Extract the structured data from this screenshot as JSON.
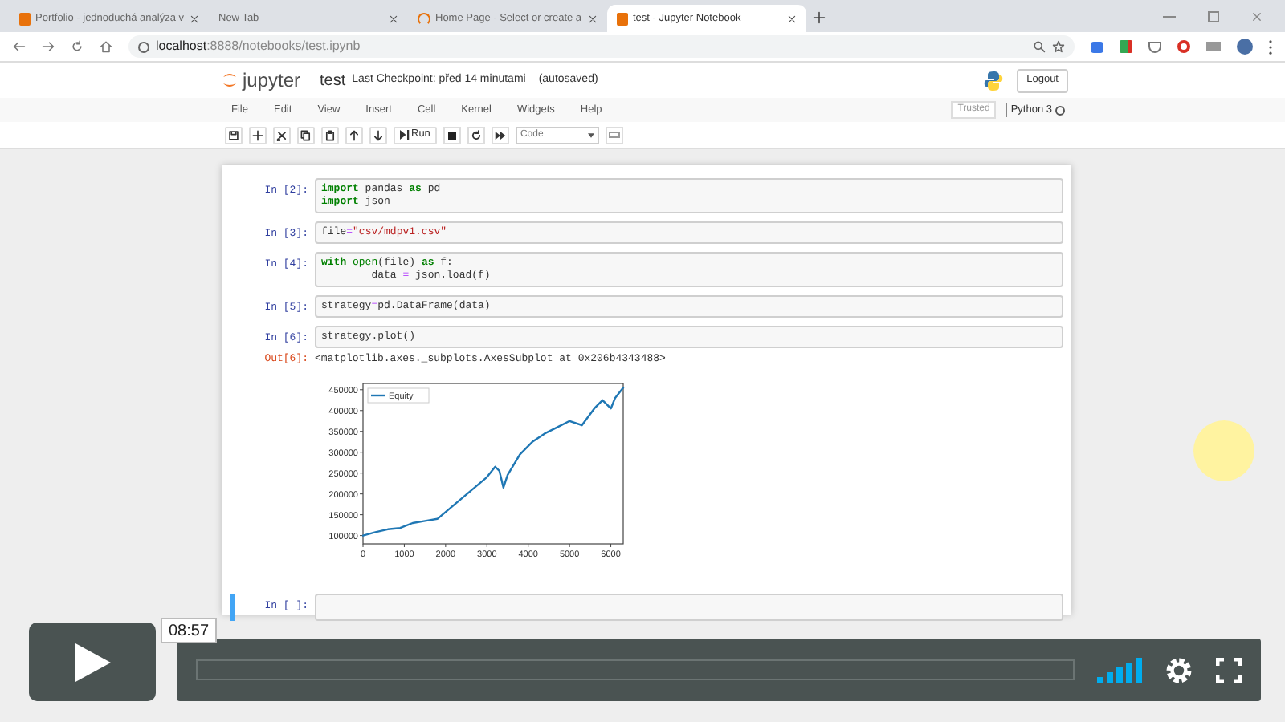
{
  "browser": {
    "tabs": [
      {
        "title": "Portfolio - jednoduchá analýza v",
        "selected": false,
        "kind": "page"
      },
      {
        "title": "New Tab",
        "selected": false,
        "kind": "plain"
      },
      {
        "title": "Home Page - Select or create a",
        "selected": false,
        "kind": "loading"
      },
      {
        "title": "test - Jupyter Notebook",
        "selected": true,
        "kind": "page"
      }
    ],
    "address": {
      "host": "localhost",
      "path": ":8888/notebooks/test.ipynb"
    }
  },
  "jupyter": {
    "logo": "jupyter",
    "notebook_name": "test",
    "checkpoint": "Last Checkpoint: před 14 minutami",
    "autosaved": "(autosaved)",
    "logout": "Logout",
    "menu": [
      "File",
      "Edit",
      "View",
      "Insert",
      "Cell",
      "Kernel",
      "Widgets",
      "Help"
    ],
    "run_label": "Run",
    "cell_type": "Code",
    "trusted": "Trusted",
    "kernel": "Python 3"
  },
  "cells": [
    {
      "prompt": "In [2]:",
      "selected": false,
      "lines": [
        [
          {
            "kind": "keyword",
            "text": "import"
          },
          {
            "kind": "plain",
            "text": " pandas "
          },
          {
            "kind": "keyword",
            "text": "as"
          },
          {
            "kind": "plain",
            "text": " pd"
          }
        ],
        [
          {
            "kind": "keyword",
            "text": "import"
          },
          {
            "kind": "plain",
            "text": " json"
          }
        ]
      ]
    },
    {
      "prompt": "In [3]:",
      "selected": false,
      "lines": [
        [
          {
            "kind": "plain",
            "text": "file"
          },
          {
            "kind": "operator",
            "text": "="
          },
          {
            "kind": "string",
            "text": "\"csv/mdpv1.csv\""
          }
        ]
      ]
    },
    {
      "prompt": "In [4]:",
      "selected": false,
      "lines": [
        [
          {
            "kind": "keyword",
            "text": "with"
          },
          {
            "kind": "builtin",
            "text": " open"
          },
          {
            "kind": "plain",
            "text": "(file) "
          },
          {
            "kind": "keyword",
            "text": "as"
          },
          {
            "kind": "plain",
            "text": " f:"
          }
        ],
        [
          {
            "kind": "plain",
            "text": "        data "
          },
          {
            "kind": "operator",
            "text": "="
          },
          {
            "kind": "plain",
            "text": " json.load(f)"
          }
        ]
      ]
    },
    {
      "prompt": "In [5]:",
      "selected": false,
      "lines": [
        [
          {
            "kind": "plain",
            "text": "strategy"
          },
          {
            "kind": "operator",
            "text": "="
          },
          {
            "kind": "plain",
            "text": "pd.DataFrame(data)"
          }
        ]
      ]
    },
    {
      "prompt": "In [6]:",
      "selected": false,
      "lines": [
        [
          {
            "kind": "plain",
            "text": "strategy.plot()"
          }
        ]
      ],
      "output": {
        "prompt": "Out[6]:",
        "text": "<matplotlib.axes._subplots.AxesSubplot at 0x206b4343488>",
        "chart_data": {
          "type": "line",
          "x": [
            0,
            300,
            600,
            900,
            1200,
            1500,
            1800,
            2100,
            2400,
            2700,
            3000,
            3200,
            3300,
            3400,
            3500,
            3800,
            4100,
            4400,
            4700,
            5000,
            5300,
            5600,
            5800,
            6000,
            6100,
            6300
          ],
          "series": [
            {
              "name": "Equity",
              "color": "#1f77b4",
              "values": [
                100000,
                108000,
                115000,
                118000,
                130000,
                135000,
                140000,
                165000,
                190000,
                215000,
                240000,
                265000,
                255000,
                215000,
                245000,
                295000,
                325000,
                345000,
                360000,
                375000,
                365000,
                405000,
                425000,
                405000,
                430000,
                455000
              ]
            }
          ],
          "xlim": [
            0,
            6300
          ],
          "ylim": [
            80000,
            465000
          ],
          "xticks": [
            0,
            1000,
            2000,
            3000,
            4000,
            5000,
            6000
          ],
          "yticks": [
            100000,
            150000,
            200000,
            250000,
            300000,
            350000,
            400000,
            450000
          ]
        }
      }
    },
    {
      "prompt": "In [ ]:",
      "selected": true
    }
  ],
  "video": {
    "time": "08:57"
  }
}
